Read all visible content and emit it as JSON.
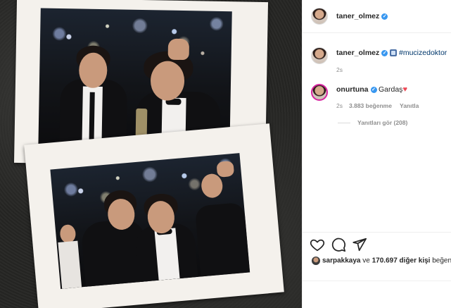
{
  "post": {
    "author": "taner_olmez",
    "caption_author": "taner_olmez",
    "caption_hashtag": "#mucizedoktor",
    "caption_age": "2s"
  },
  "comment": {
    "author": "onurtuna",
    "text": "Gardaş",
    "age": "2s",
    "likes": "3.883 beğenme",
    "reply_label": "Yanıtla",
    "view_replies": "Yanıtları gör (208)"
  },
  "likes_line": {
    "user": "sarpakkaya",
    "connector": "ve",
    "count": "170.697 diğer kişi",
    "suffix": "beğen"
  },
  "icons": {
    "like": "heart-outline-icon",
    "comment": "comment-bubble-icon",
    "share": "paper-plane-icon",
    "verified": "verified-badge-icon"
  },
  "colors": {
    "verified": "#3897f0",
    "hashtag": "#00376b",
    "heart": "#ed4956",
    "story_ring": "#d6249f",
    "muted": "#8e8e8e"
  }
}
